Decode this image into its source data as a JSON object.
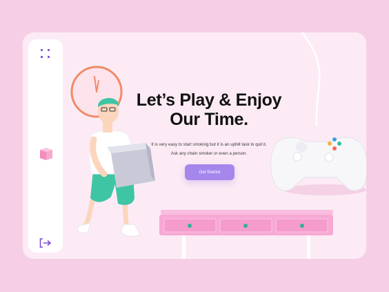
{
  "hero": {
    "title_line1": "Let’s Play & Enjoy",
    "title_line2": "Our Time.",
    "description_line1": "It is very easy to start smoking but it is an uphill task to quit it.",
    "description_line2": "Ask any chain smoker or even a person.",
    "cta_label": "Get Started"
  },
  "sidebar": {
    "icons": [
      "menu-dots-icon",
      "cube-icon",
      "logout-icon"
    ]
  },
  "colors": {
    "background": "#f6cfe6",
    "card": "#fcebf5",
    "accent": "#a587ec",
    "icon": "#7b4bd0",
    "table": "#f7a9d3",
    "clock": "#f08a66"
  }
}
